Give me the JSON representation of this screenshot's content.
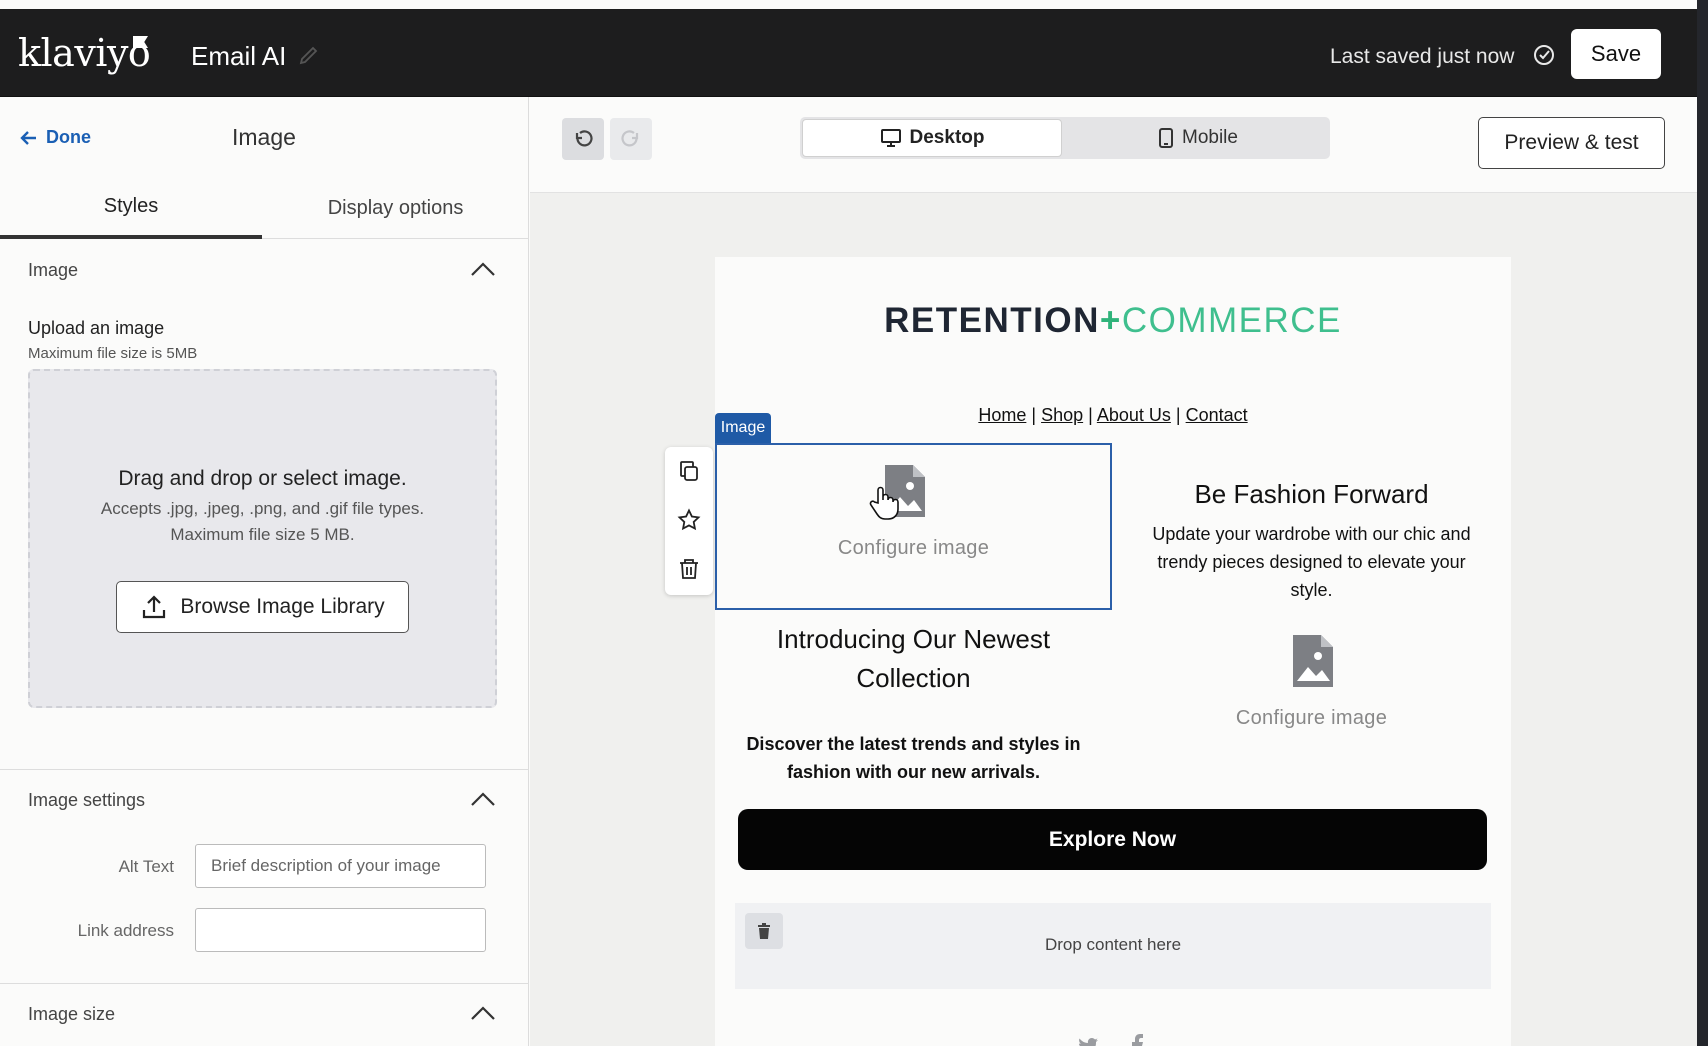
{
  "header": {
    "logo_text": "klaviyo",
    "app_title": "Email AI",
    "saved_status": "Last saved just now",
    "save_label": "Save"
  },
  "left_panel": {
    "back_label": "Done",
    "title": "Image",
    "tabs": [
      {
        "label": "Styles",
        "active": true
      },
      {
        "label": "Display options",
        "active": false
      }
    ],
    "image_section": {
      "title": "Image",
      "upload_label": "Upload an image",
      "upload_sub": "Maximum file size is 5MB",
      "dropzone_title": "Drag and drop or select image.",
      "dropzone_line1": "Accepts .jpg, .jpeg, .png, and .gif file types.",
      "dropzone_line2": "Maximum file size 5 MB.",
      "browse_label": "Browse Image Library"
    },
    "settings_section": {
      "title": "Image settings",
      "alt_label": "Alt Text",
      "alt_placeholder": "Brief description of your image",
      "alt_value": "",
      "link_label": "Link address",
      "link_value": ""
    },
    "size_section": {
      "title": "Image size"
    }
  },
  "toolbar": {
    "view_options": [
      {
        "label": "Desktop",
        "active": true
      },
      {
        "label": "Mobile",
        "active": false
      }
    ],
    "preview_label": "Preview & test"
  },
  "email": {
    "brand_part1": "RETENTION",
    "brand_plus": "+",
    "brand_part2": "COMMERCE",
    "nav": [
      "Home",
      "Shop",
      "About Us",
      "Contact"
    ],
    "nav_separator": "|",
    "selected_tag": "Image",
    "configure_image_label": "Configure image",
    "right_heading": "Be Fashion Forward",
    "right_body": "Update your wardrobe with our chic and trendy pieces designed to elevate your style.",
    "left_heading": "Introducing Our Newest Collection",
    "left_body": "Discover the latest trends and styles in fashion with our new arrivals.",
    "cta_label": "Explore Now",
    "drop_text": "Drop content here"
  },
  "colors": {
    "topbar": "#1d1d1e",
    "accent_blue": "#1f5aa6",
    "brand_dark": "#1f2633",
    "brand_green": "#3fbf8e"
  }
}
